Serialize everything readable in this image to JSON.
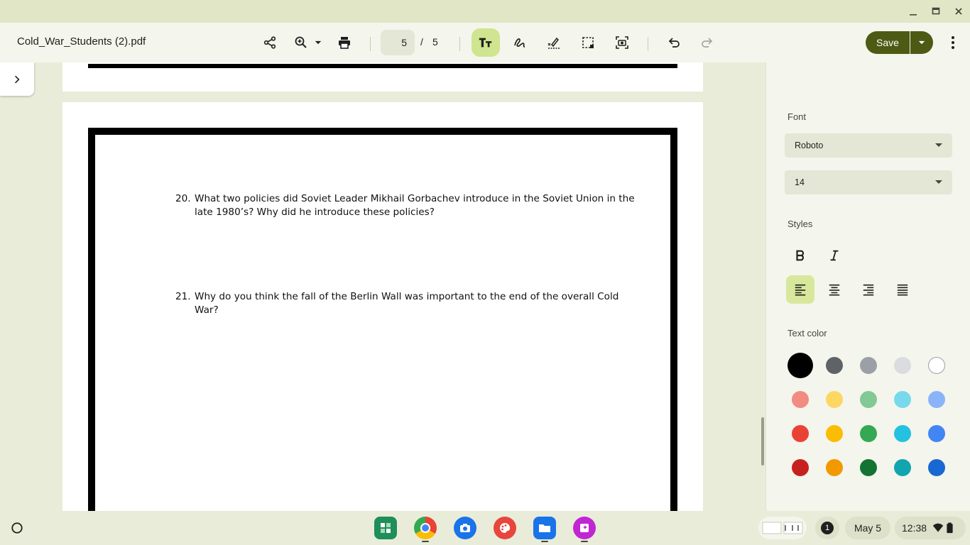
{
  "window": {
    "minimize_icon": "minimize-icon",
    "maximize_icon": "maximize-icon",
    "close_icon": "close-icon"
  },
  "toolbar": {
    "doc_title": "Cold_War_Students (2).pdf",
    "current_page": "5",
    "page_separator": "/",
    "total_pages": "5",
    "save_label": "Save"
  },
  "document": {
    "questions": [
      {
        "number": "20.",
        "line1": "What two policies did Soviet Leader Mikhail Gorbachev introduce in the Soviet Union in the",
        "line2": "late 1980’s? Why did he introduce these policies?"
      },
      {
        "number": "21.",
        "line1": "Why do you think the fall of the Berlin Wall was important to the end of the overall Cold",
        "line2": "War?"
      }
    ]
  },
  "panel": {
    "font_label": "Font",
    "font_value": "Roboto",
    "size_value": "14",
    "styles_label": "Styles",
    "text_color_label": "Text color",
    "selected_color": "#000000",
    "colors": [
      [
        "#000000",
        "#5f6368",
        "#9aa0a6",
        "#dadce0",
        "#ffffff"
      ],
      [
        "#f28b82",
        "#fdd663",
        "#81c995",
        "#78d9ec",
        "#8ab4f8"
      ],
      [
        "#ea4335",
        "#fbbc04",
        "#34a853",
        "#24c1e0",
        "#4285f4"
      ],
      [
        "#c5221f",
        "#f29900",
        "#137333",
        "#12a4af",
        "#1967d2"
      ]
    ]
  },
  "shelf": {
    "notification_count": "1",
    "date": "May 5",
    "time": "12:38"
  }
}
